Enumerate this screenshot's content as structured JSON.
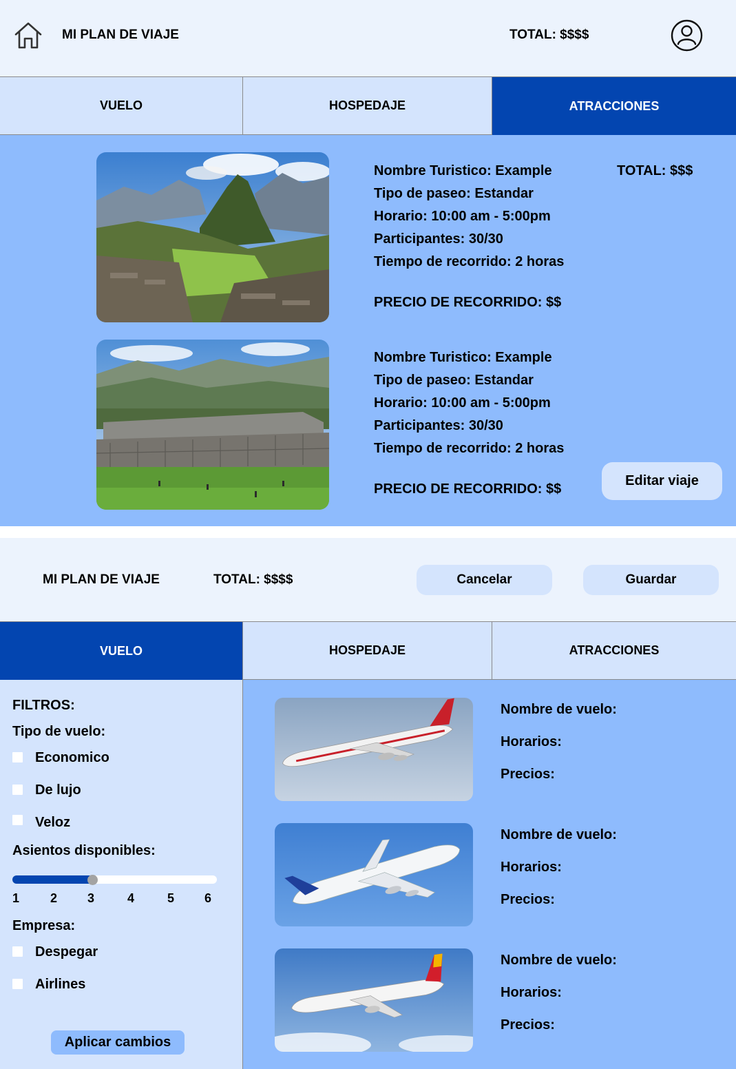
{
  "screen1": {
    "header": {
      "title": "MI PLAN DE VIAJE",
      "total": "TOTAL: $$$$"
    },
    "tabs": [
      {
        "label": "VUELO",
        "active": false
      },
      {
        "label": "HOSPEDAJE",
        "active": false
      },
      {
        "label": "ATRACCIONES",
        "active": true
      }
    ],
    "attractions": [
      {
        "nombre": "Nombre Turistico: Example",
        "tipo": "Tipo de paseo: Estandar",
        "horario": "Horario: 10:00 am - 5:00pm",
        "participantes": "Participantes: 30/30",
        "tiempo": "Tiempo de recorrido: 2 horas",
        "precio": "PRECIO DE RECORRIDO: $$",
        "image": "machu-picchu-photo"
      },
      {
        "nombre": "Nombre Turistico: Example",
        "tipo": "Tipo de paseo: Estandar",
        "horario": "Horario: 10:00 am - 5:00pm",
        "participantes": "Participantes: 30/30",
        "tiempo": "Tiempo de recorrido: 2 horas",
        "precio": "PRECIO DE RECORRIDO: $$",
        "image": "sacsayhuaman-photo"
      }
    ],
    "attractions_total": "TOTAL: $$$",
    "edit_button": "Editar viaje"
  },
  "screen2": {
    "header": {
      "title": "MI PLAN DE VIAJE",
      "total": "TOTAL: $$$$",
      "cancel": "Cancelar",
      "save": "Guardar"
    },
    "tabs": [
      {
        "label": "VUELO",
        "active": true
      },
      {
        "label": "HOSPEDAJE",
        "active": false
      },
      {
        "label": "ATRACCIONES",
        "active": false
      }
    ],
    "filters": {
      "title": "FILTROS:",
      "tipo_label": "Tipo de vuelo:",
      "tipo_options": [
        "Economico",
        "De lujo",
        "Veloz"
      ],
      "asientos_label": "Asientos disponibles:",
      "slider_labels": [
        "1",
        "2",
        "3",
        "4",
        "5",
        "6"
      ],
      "slider_value": 3,
      "empresa_label": "Empresa:",
      "empresa_options": [
        "Despegar",
        "Airlines"
      ],
      "apply_button": "Aplicar cambios"
    },
    "flights": [
      {
        "nombre": "Nombre de vuelo:",
        "horarios": "Horarios:",
        "precios": "Precios:",
        "image": "air-india-747-photo"
      },
      {
        "nombre": "Nombre de vuelo:",
        "horarios": "Horarios:",
        "precios": "Precios:",
        "image": "airbus-a380-photo"
      },
      {
        "nombre": "Nombre de vuelo:",
        "horarios": "Horarios:",
        "precios": "Precios:",
        "image": "iberia-a320-photo"
      }
    ]
  },
  "colors": {
    "header_bg": "#ecf3fd",
    "tab_bg": "#d4e4fd",
    "tab_active": "#0345b0",
    "content_bg": "#8ebbfd",
    "button_bg": "#d4e4fd"
  }
}
